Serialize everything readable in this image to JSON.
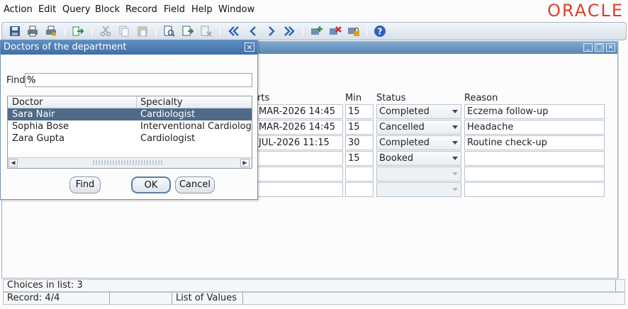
{
  "menu": [
    "Action",
    "Edit",
    "Query",
    "Block",
    "Record",
    "Field",
    "Help",
    "Window"
  ],
  "brand": {
    "logo_text": "ORACLE",
    "color": "#d8402a"
  },
  "toolbar": {
    "icons": [
      "save-icon",
      "print-icon",
      "print-setup-icon",
      "exit-icon",
      "cut-icon",
      "copy-icon",
      "paste-icon",
      "query-icon",
      "execute-query-icon",
      "cancel-query-icon",
      "first-record-icon",
      "previous-record-icon",
      "next-record-icon",
      "last-record-icon",
      "insert-record-icon",
      "delete-record-icon",
      "lock-record-icon",
      "help-icon"
    ]
  },
  "form": {
    "columns": {
      "starts": "rts",
      "min": "Min",
      "status": "Status",
      "reason": "Reason"
    },
    "rows": [
      {
        "starts": "MAR-2026 14:45",
        "min": "15",
        "status": "Completed",
        "reason": "Eczema follow-up"
      },
      {
        "starts": "MAR-2026 14:45",
        "min": "15",
        "status": "Cancelled",
        "reason": "Headache"
      },
      {
        "starts": "JUL-2026 11:15",
        "min": "30",
        "status": "Completed",
        "reason": "Routine check-up"
      },
      {
        "starts": "",
        "min": "15",
        "status": "Booked",
        "reason": ""
      },
      {
        "starts": "",
        "min": "",
        "status": "",
        "reason": ""
      },
      {
        "starts": "",
        "min": "",
        "status": "",
        "reason": ""
      }
    ]
  },
  "lov": {
    "title": "Doctors of the department",
    "find_label": "Find",
    "find_value": "%",
    "columns": {
      "doctor": "Doctor",
      "specialty": "Specialty"
    },
    "rows": [
      {
        "doctor": "Sara Nair",
        "specialty": "Cardiologist",
        "selected": true
      },
      {
        "doctor": "Sophia Bose",
        "specialty": "Interventional Cardiology",
        "selected": false
      },
      {
        "doctor": "Zara Gupta",
        "specialty": "Cardiologist",
        "selected": false
      }
    ],
    "buttons": {
      "find": "Find",
      "ok": "OK",
      "cancel": "Cancel"
    }
  },
  "status": {
    "message": "Choices in list: 3",
    "record": "Record: 4/4",
    "mode": "List of Values"
  },
  "colors": {
    "selection": "#4f6b89",
    "titlebar": "#3f6fa3"
  }
}
